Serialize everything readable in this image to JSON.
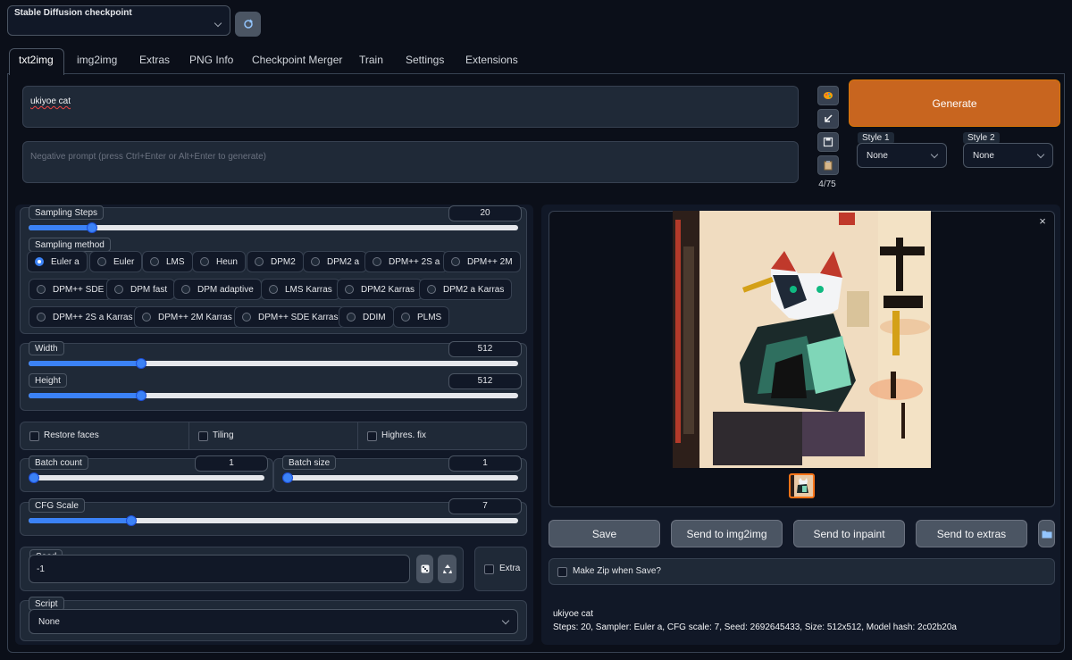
{
  "checkpoint": {
    "label": "Stable Diffusion checkpoint",
    "value": "",
    "refresh_icon": "refresh-icon"
  },
  "tabs": [
    {
      "label": "txt2img"
    },
    {
      "label": "img2img"
    },
    {
      "label": "Extras"
    },
    {
      "label": "PNG Info"
    },
    {
      "label": "Checkpoint Merger"
    },
    {
      "label": "Train"
    },
    {
      "label": "Settings"
    },
    {
      "label": "Extensions"
    }
  ],
  "prompt": {
    "value": "ukiyoe cat",
    "negative_placeholder": "Negative prompt (press Ctrl+Enter or Alt+Enter to generate)",
    "token_count": "4/75"
  },
  "toolbar_icons": [
    "palette-icon",
    "arrow-icon",
    "save-icon",
    "clipboard-icon"
  ],
  "generate_label": "Generate",
  "style1": {
    "label": "Style 1",
    "value": "None"
  },
  "style2": {
    "label": "Style 2",
    "value": "None"
  },
  "sampling_steps": {
    "label": "Sampling Steps",
    "value": "20",
    "fraction": 0.13
  },
  "sampling_method": {
    "label": "Sampling method",
    "selected": "Euler a",
    "options": [
      "Euler a",
      "Euler",
      "LMS",
      "Heun",
      "DPM2",
      "DPM2 a",
      "DPM++ 2S a",
      "DPM++ 2M",
      "DPM++ SDE",
      "DPM fast",
      "DPM adaptive",
      "LMS Karras",
      "DPM2 Karras",
      "DPM2 a Karras",
      "DPM++ 2S a Karras",
      "DPM++ 2M Karras",
      "DPM++ SDE Karras",
      "DDIM",
      "PLMS"
    ]
  },
  "width": {
    "label": "Width",
    "value": "512",
    "fraction": 0.23
  },
  "height": {
    "label": "Height",
    "value": "512",
    "fraction": 0.23
  },
  "checkboxes": {
    "restore_faces": "Restore faces",
    "tiling": "Tiling",
    "highres": "Highres. fix"
  },
  "batch_count": {
    "label": "Batch count",
    "value": "1",
    "fraction": 0.0
  },
  "batch_size": {
    "label": "Batch size",
    "value": "1",
    "fraction": 0.0
  },
  "cfg_scale": {
    "label": "CFG Scale",
    "value": "7",
    "fraction": 0.21
  },
  "seed": {
    "label": "Seed",
    "value": "-1",
    "dice_icon": "dice-icon",
    "recycle_icon": "recycle-icon",
    "extra_label": "Extra"
  },
  "script": {
    "label": "Script",
    "value": "None"
  },
  "output": {
    "close_icon": "close-icon",
    "image_caption": "ukiyoe cat",
    "buttons": {
      "save": "Save",
      "img2img": "Send to img2img",
      "inpaint": "Send to inpaint",
      "extras": "Send to extras"
    },
    "folder_icon": "folder-icon",
    "make_zip": "Make Zip when Save?",
    "info_prompt": "ukiyoe cat",
    "info_params": "Steps: 20, Sampler: Euler a, CFG scale: 7, Seed: 2692645433, Size: 512x512, Model hash: 2c02b20a"
  }
}
